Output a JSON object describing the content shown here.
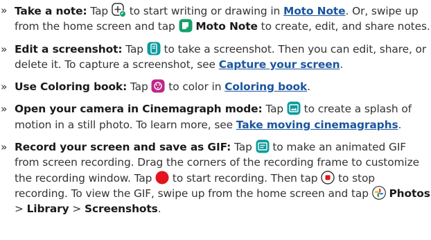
{
  "items": [
    {
      "lead": "Take a note:",
      "t1": "Tap",
      "t2": "to start writing or drawing in",
      "link1": "Moto Note",
      "t3": ". Or, swipe up from the home screen and tap",
      "bold1": "Moto Note",
      "t4": "to create, edit, and share notes."
    },
    {
      "lead": "Edit a screenshot:",
      "t1": "Tap",
      "t2": "to take a screenshot. Then you can edit, share, or delete it. To capture a screenshot, see",
      "link1": "Capture your screen",
      "t3": "."
    },
    {
      "lead": "Use Coloring book:",
      "t1": "Tap",
      "t2": "to color in",
      "link1": "Coloring book",
      "t3": "."
    },
    {
      "lead": "Open your camera in Cinemagraph mode:",
      "t1": "Tap",
      "t2": "to create a splash of motion in a still photo. To learn more, see",
      "link1": "Take moving cinemagraphs",
      "t3": "."
    },
    {
      "lead": "Record your screen and save as GIF:",
      "t1": "Tap",
      "t2": "to make an animated GIF from screen recording. Drag the corners of the recording frame to customize the recording window. Tap",
      "t3": "to start recording. Then tap",
      "t4": "to stop recording. To view the GIF, swipe up from the home screen and tap",
      "bold1": "Photos",
      "sep1": ">",
      "bold2": "Library",
      "sep2": ">",
      "bold3": "Screenshots",
      "t5": "."
    }
  ],
  "bullet": "»",
  "colors": {
    "text": "#333333",
    "link": "#1b56a0",
    "note_icon": "#16a06c",
    "screenshot_icon": "#0e9c9c",
    "coloring_icon": "#c0268a",
    "record_red": "#e3141c"
  }
}
